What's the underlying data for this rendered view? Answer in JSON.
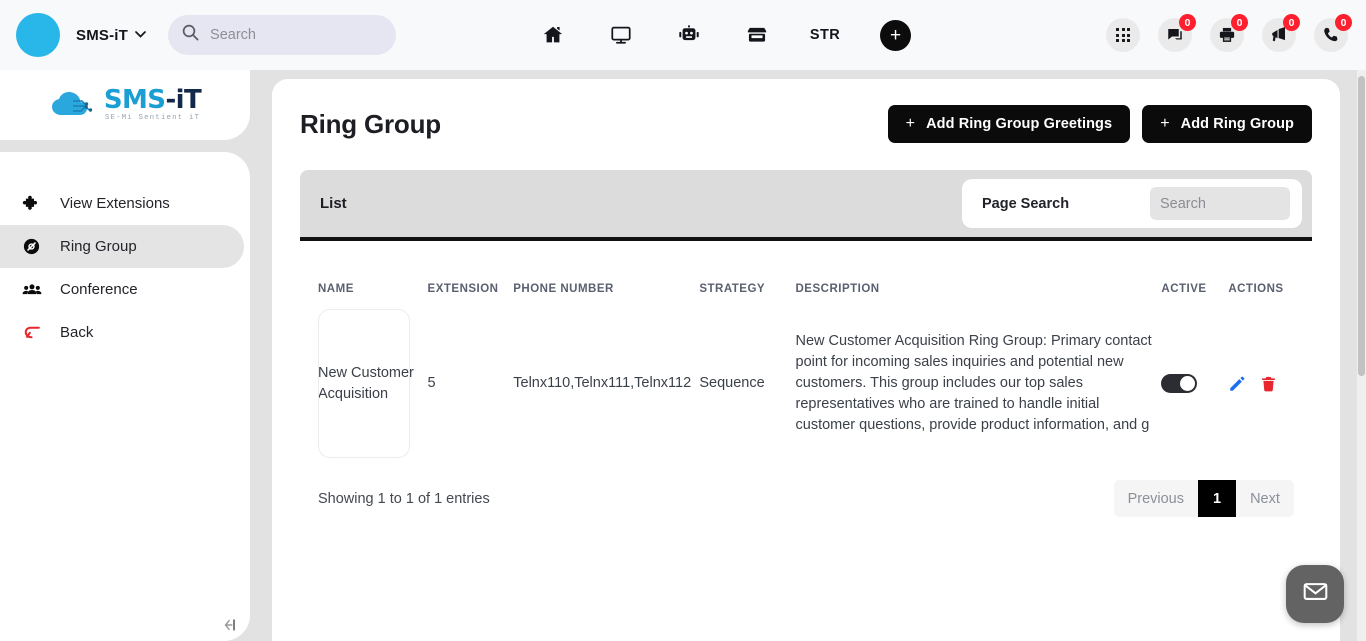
{
  "topbar": {
    "brand_name": "SMS-iT",
    "brand_color": "#29b6e8",
    "caret": "⌄",
    "search": {
      "value": "",
      "placeholder": "Search"
    },
    "nav": [
      {
        "name": "home-icon",
        "label": ""
      },
      {
        "name": "monitor-icon",
        "label": ""
      },
      {
        "name": "robot-icon",
        "label": ""
      },
      {
        "name": "store-icon",
        "label": ""
      },
      {
        "name": "str-text",
        "label": "STR"
      }
    ],
    "add_button_label": "+",
    "right_icons": [
      {
        "name": "app-grid-icon",
        "badge": ""
      },
      {
        "name": "chat-icon",
        "badge": "0"
      },
      {
        "name": "printer-icon",
        "badge": "0"
      },
      {
        "name": "megaphone-icon",
        "badge": "0"
      },
      {
        "name": "phone-icon",
        "badge": "0"
      }
    ],
    "badge_color": "#ff1f2e"
  },
  "sidebar": {
    "logo": {
      "main_1": "SMS",
      "main_2": "-iT",
      "tagline": "SE-Mi Sentient iT"
    },
    "items": [
      {
        "label": "View Extensions",
        "icon": "puzzle-icon",
        "active": false
      },
      {
        "label": "Ring Group",
        "icon": "ring-group-icon",
        "active": true
      },
      {
        "label": "Conference",
        "icon": "people-icon",
        "active": false
      },
      {
        "label": "Back",
        "icon": "back-arrow-icon",
        "active": false
      }
    ],
    "collapse_label": "←"
  },
  "main": {
    "page_title": "Ring Group",
    "buttons": {
      "add_greetings": "Add Ring Group Greetings",
      "add_ring_group": "Add Ring Group",
      "plus": "+"
    },
    "list": {
      "title": "List",
      "page_search_label": "Page Search",
      "page_search": {
        "value": "",
        "placeholder": "Search"
      }
    },
    "table": {
      "columns": [
        "NAME",
        "EXTENSION",
        "PHONE NUMBER",
        "STRATEGY",
        "DESCRIPTION",
        "ACTIVE",
        "ACTIONS"
      ],
      "rows": [
        {
          "name": "New Customer Acquisition",
          "extension": "5",
          "phone_number": "Telnx110,Telnx111,Telnx112",
          "strategy": "Sequence",
          "description": "New Customer Acquisition Ring Group: Primary contact point for incoming sales inquiries and potential new customers. This group includes our top sales representatives who are trained to handle initial customer questions, provide product information, and g",
          "active": true,
          "edit_icon": "pencil-icon",
          "delete_icon": "trash-icon",
          "edit_color": "#1b6ef3",
          "delete_color": "#e8262d"
        }
      ]
    },
    "footer": {
      "entries_text": "Showing 1 to 1 of 1 entries",
      "pagination": {
        "previous": "Previous",
        "current_page": "1",
        "next": "Next"
      }
    }
  },
  "fab": {
    "icon": "envelope-icon",
    "color": "#636363"
  }
}
